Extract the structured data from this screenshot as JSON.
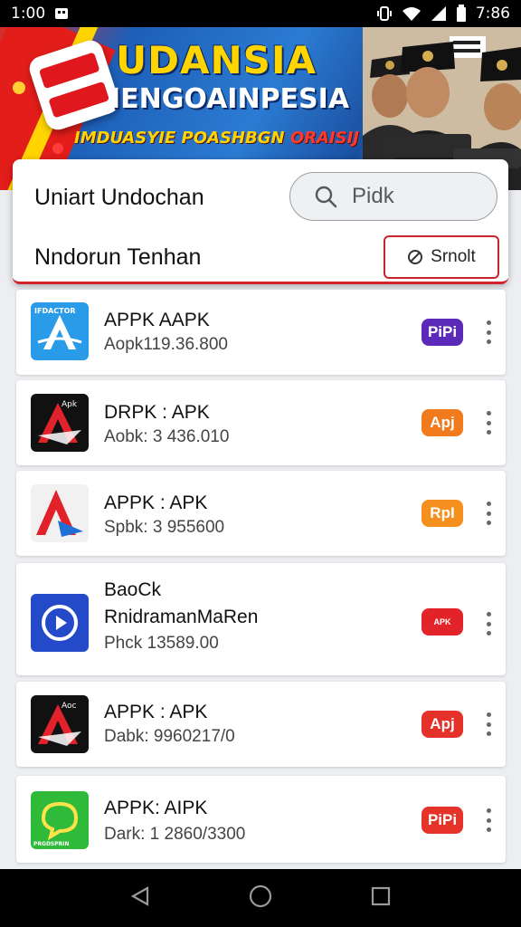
{
  "status_bar": {
    "time_left": "1:00",
    "time_right": "7:86"
  },
  "banner": {
    "title": "UDANSIA",
    "subtitle": "IENGOAINPESIA",
    "tagline_a": "IMDUASYIE POASHBGN",
    "tagline_b": "ORAISIJ"
  },
  "card": {
    "title": "Uniart Undochan",
    "subtitle": "Nndorun Tenhan",
    "search_placeholder": "Pidk",
    "sort_label": "Srnolt"
  },
  "apps": [
    {
      "line1": "APPK AAPK",
      "line2": "Aopk119.36.800",
      "badge": "PiPi",
      "badge_color": "#5b2ab8",
      "icon": "a-blue-icon",
      "icon_text": "IFDACTOR"
    },
    {
      "line1": "DRPK : APK",
      "line2": "Aobk: 3 436.010",
      "badge": "Apj",
      "badge_color": "#f07a1c",
      "icon": "a-black-red-icon",
      "icon_text": "Apk"
    },
    {
      "line1": "APPK : APK",
      "line2": "Spbk: 3 955600",
      "badge": "RpI",
      "badge_color": "#f5901e",
      "icon": "a-white-red-icon",
      "icon_text": ""
    },
    {
      "line1": "BaoCk",
      "line1b": "RnidramanMaRen",
      "line2": "Phck 13589.00",
      "badge": "APK",
      "badge_color": "#e3232a",
      "icon": "play-blue-icon",
      "icon_text": ""
    },
    {
      "line1": "APPK : APK",
      "line2": "Dabk: 9960217/0",
      "badge": "Apj",
      "badge_color": "#e4322a",
      "icon": "a-black-red-icon",
      "icon_text": "Aoc"
    },
    {
      "line1": "APPK: AIPK",
      "line2": "Dark: 1 2860/3300",
      "badge": "PiPi",
      "badge_color": "#e6332a",
      "icon": "green-chat-icon",
      "icon_text": "PRGDSPRIN"
    }
  ],
  "colors": {
    "accent_red": "#d0232a",
    "banner_blue": "#1d5fb8",
    "banner_yellow": "#ffd500"
  }
}
